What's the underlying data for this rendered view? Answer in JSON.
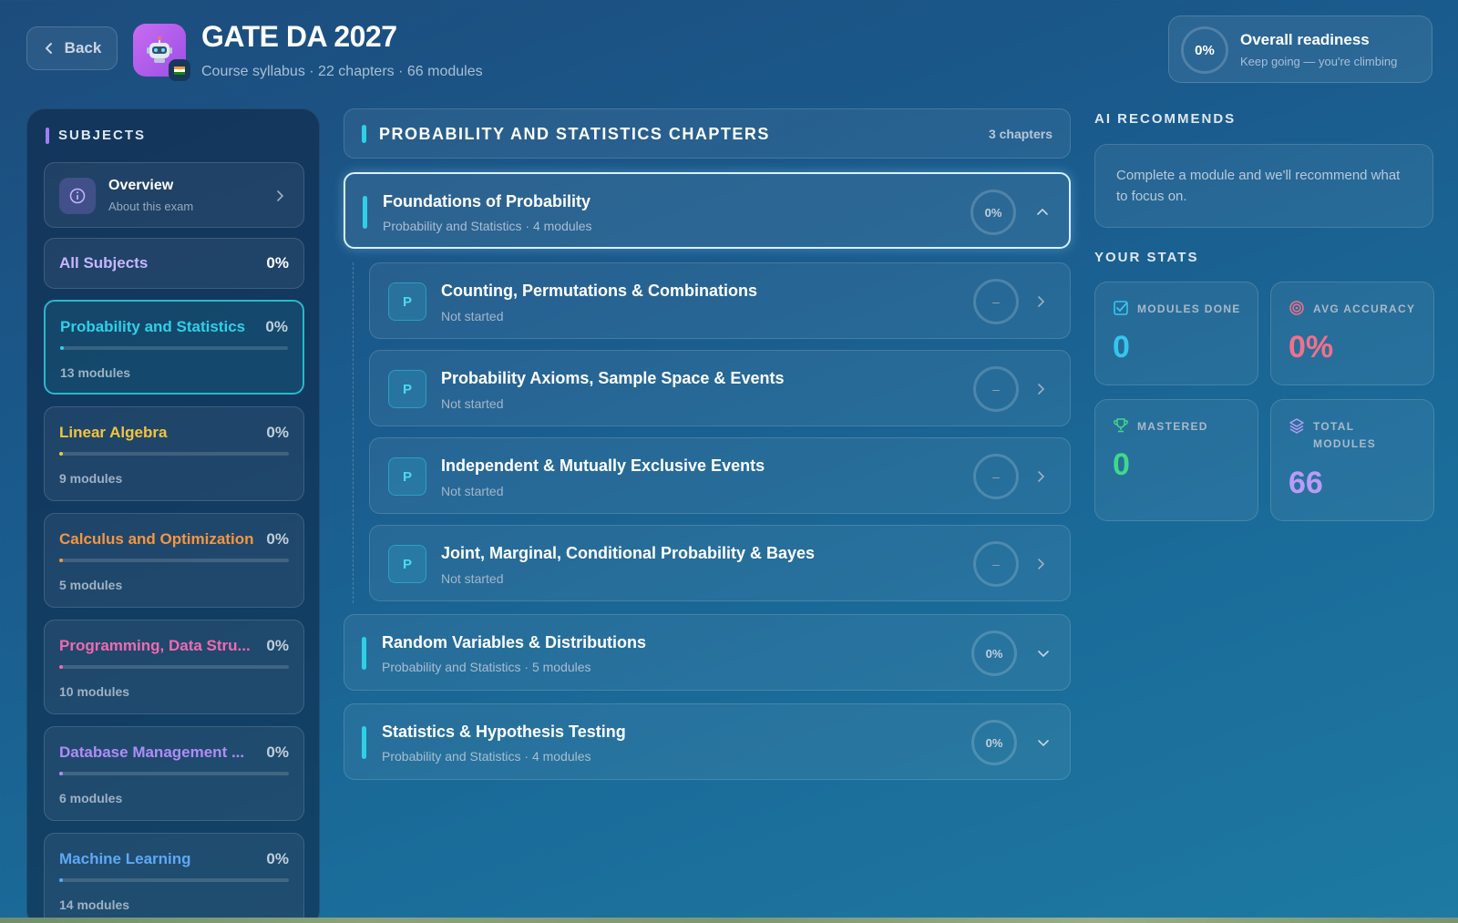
{
  "header": {
    "back_label": "Back",
    "title": "GATE DA 2027",
    "subtitle": "Course syllabus · 22 chapters · 66 modules",
    "readiness": {
      "percent": "0%",
      "title": "Overall readiness",
      "subtitle": "Keep going — you're climbing"
    }
  },
  "sidebar": {
    "heading": "SUBJECTS",
    "overview": {
      "title": "Overview",
      "subtitle": "About this exam"
    },
    "all_subjects": {
      "label": "All Subjects",
      "percent": "0%"
    },
    "subjects": [
      {
        "name": "Probability and Statistics",
        "percent": "0%",
        "progress": 0,
        "modules": "13 modules",
        "color": "#2fd0e6",
        "active": true
      },
      {
        "name": "Linear Algebra",
        "percent": "0%",
        "progress": 0,
        "modules": "9 modules",
        "color": "#f3c53c",
        "active": false
      },
      {
        "name": "Calculus and Optimization",
        "percent": "0%",
        "progress": 0,
        "modules": "5 modules",
        "color": "#f7953f",
        "active": false
      },
      {
        "name": "Programming, Data Stru...",
        "percent": "0%",
        "progress": 0,
        "modules": "10 modules",
        "color": "#f06ab0",
        "active": false
      },
      {
        "name": "Database Management ...",
        "percent": "0%",
        "progress": 0,
        "modules": "6 modules",
        "color": "#b08cf5",
        "active": false
      },
      {
        "name": "Machine Learning",
        "percent": "0%",
        "progress": 0,
        "modules": "14 modules",
        "color": "#5fa8f5",
        "active": false
      }
    ]
  },
  "main": {
    "section_title": "PROBABILITY AND STATISTICS CHAPTERS",
    "chapter_count": "3 chapters",
    "chapters": [
      {
        "title": "Foundations of Probability",
        "subtitle": "Probability and Statistics · 4 modules",
        "percent": "0%"
      },
      {
        "title": "Random Variables & Distributions",
        "subtitle": "Probability and Statistics · 5 modules",
        "percent": "0%"
      },
      {
        "title": "Statistics & Hypothesis Testing",
        "subtitle": "Probability and Statistics · 4 modules",
        "percent": "0%"
      }
    ],
    "modules": [
      {
        "badge": "P",
        "title": "Counting, Permutations & Combinations",
        "status": "Not started",
        "score": "–"
      },
      {
        "badge": "P",
        "title": "Probability Axioms, Sample Space & Events",
        "status": "Not started",
        "score": "–"
      },
      {
        "badge": "P",
        "title": "Independent & Mutually Exclusive Events",
        "status": "Not started",
        "score": "–"
      },
      {
        "badge": "P",
        "title": "Joint, Marginal, Conditional Probability & Bayes",
        "status": "Not started",
        "score": "–"
      }
    ]
  },
  "right": {
    "ai_heading": "AI RECOMMENDS",
    "ai_text": "Complete a module and we'll recommend what to focus on.",
    "stats_heading": "YOUR STATS",
    "stats": [
      {
        "label": "MODULES DONE",
        "value": "0",
        "color": "#35c6ee",
        "icon": "check-square-icon"
      },
      {
        "label": "AVG ACCURACY",
        "value": "0%",
        "color": "#f2708a",
        "icon": "target-icon"
      },
      {
        "label": "MASTERED",
        "value": "0",
        "color": "#3fd98a",
        "icon": "trophy-icon"
      },
      {
        "label": "TOTAL MODULES",
        "value": "66",
        "color": "#b99cf6",
        "icon": "layers-icon"
      }
    ]
  }
}
